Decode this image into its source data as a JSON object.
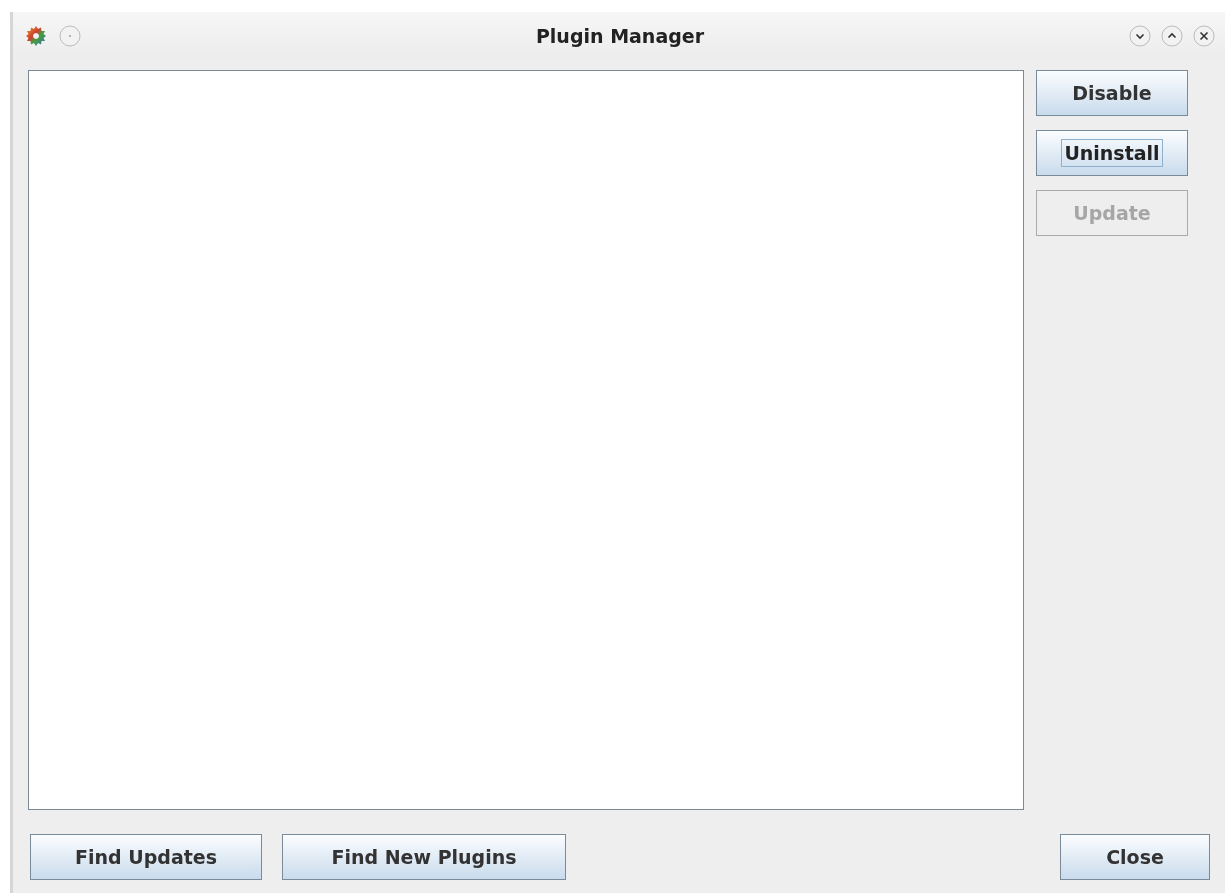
{
  "window": {
    "title": "Plugin Manager"
  },
  "side_buttons": [
    {
      "label": "Disable",
      "disabled": false,
      "focused": false
    },
    {
      "label": "Uninstall",
      "disabled": false,
      "focused": true
    },
    {
      "label": "Update",
      "disabled": true,
      "focused": false
    }
  ],
  "bottom_buttons": [
    {
      "label": "Find Updates",
      "disabled": false,
      "focused": false
    },
    {
      "label": "Find New Plugins",
      "disabled": false,
      "focused": false
    }
  ],
  "close_button": {
    "label": "Close",
    "disabled": false,
    "focused": false
  }
}
